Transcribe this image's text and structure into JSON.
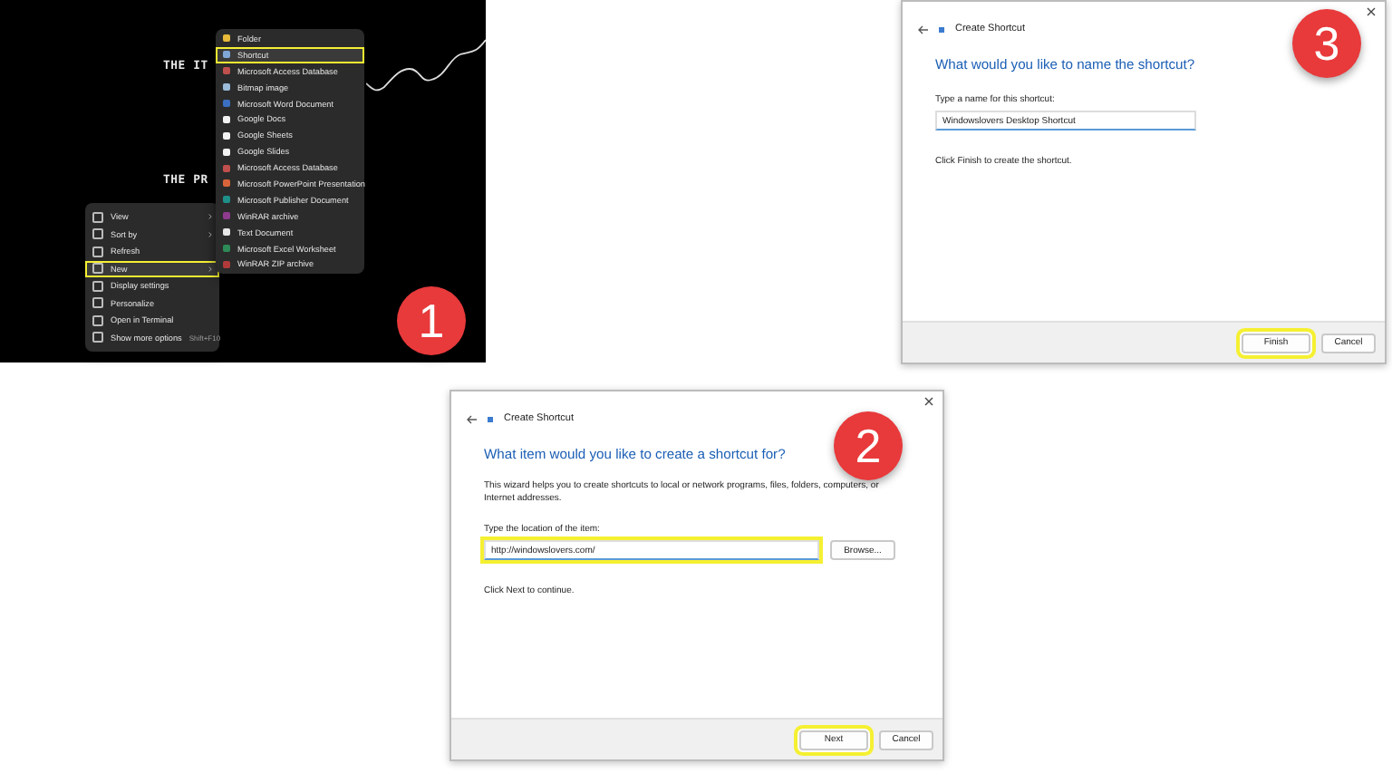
{
  "steps": [
    {
      "kind": "desktop",
      "badge": "1",
      "wallpaper_lines": [
        "THE IT",
        "THE PR"
      ],
      "context_menu": [
        {
          "label": "View",
          "arrow": true,
          "annotated": false
        },
        {
          "label": "Sort by",
          "arrow": true,
          "annotated": false
        },
        {
          "label": "Refresh",
          "arrow": false,
          "annotated": false
        },
        {
          "label": "New",
          "arrow": true,
          "annotated": true
        },
        {
          "label": "Display settings",
          "arrow": false,
          "annotated": false
        },
        {
          "label": "Personalize",
          "arrow": false,
          "annotated": false
        },
        {
          "label": "Open in Terminal",
          "arrow": false,
          "annotated": false
        },
        {
          "label": "Show more options",
          "shortcut": "Shift+F10",
          "arrow": false,
          "annotated": false
        }
      ],
      "submenu": [
        {
          "label": "Folder",
          "annotated": false,
          "color": "#e8b93a"
        },
        {
          "label": "Shortcut",
          "annotated": true,
          "color": "#7fa7d6"
        },
        {
          "label": "Microsoft Access Database",
          "annotated": false,
          "color": "#c0504d"
        },
        {
          "label": "Bitmap image",
          "annotated": false,
          "color": "#9bbbd9"
        },
        {
          "label": "Microsoft Word Document",
          "annotated": false,
          "color": "#3b6fc2"
        },
        {
          "label": "Google Docs",
          "annotated": false,
          "color": "#f2f2f2"
        },
        {
          "label": "Google Sheets",
          "annotated": false,
          "color": "#f2f2f2"
        },
        {
          "label": "Google Slides",
          "annotated": false,
          "color": "#f2f2f2"
        },
        {
          "label": "Microsoft Access Database",
          "annotated": false,
          "color": "#c0504d"
        },
        {
          "label": "Microsoft PowerPoint Presentation",
          "annotated": false,
          "color": "#d9643a"
        },
        {
          "label": "Microsoft Publisher Document",
          "annotated": false,
          "color": "#1f8f8a"
        },
        {
          "label": "WinRAR archive",
          "annotated": false,
          "color": "#8e3b8e"
        },
        {
          "label": "Text Document",
          "annotated": false,
          "color": "#e6e6e6"
        },
        {
          "label": "Microsoft Excel Worksheet",
          "annotated": false,
          "color": "#2e8b57"
        },
        {
          "label": "WinRAR ZIP archive",
          "annotated": false,
          "color": "#b03a3a"
        }
      ]
    },
    {
      "kind": "dialog",
      "badge": "3",
      "title": "Create Shortcut",
      "heading": "What would you like to name the shortcut?",
      "field_label": "Type a name for this shortcut:",
      "field_value": "Windowslovers Desktop Shortcut",
      "field_annotated": false,
      "hint": "Click Finish to create the shortcut.",
      "buttons": [
        {
          "label": "Finish",
          "annotated": true
        },
        {
          "label": "Cancel",
          "annotated": false
        }
      ]
    },
    {
      "kind": "dialog",
      "badge": "2",
      "title": "Create Shortcut",
      "heading": "What item would you like to create a shortcut for?",
      "intro": "This wizard helps you to create shortcuts to local or network programs, files, folders, computers, or Internet addresses.",
      "field_label": "Type the location of the item:",
      "field_value": "http://windowslovers.com/",
      "field_annotated": true,
      "browse": "Browse...",
      "hint": "Click Next to continue.",
      "buttons": [
        {
          "label": "Next",
          "annotated": true
        },
        {
          "label": "Cancel",
          "annotated": false
        }
      ]
    }
  ]
}
